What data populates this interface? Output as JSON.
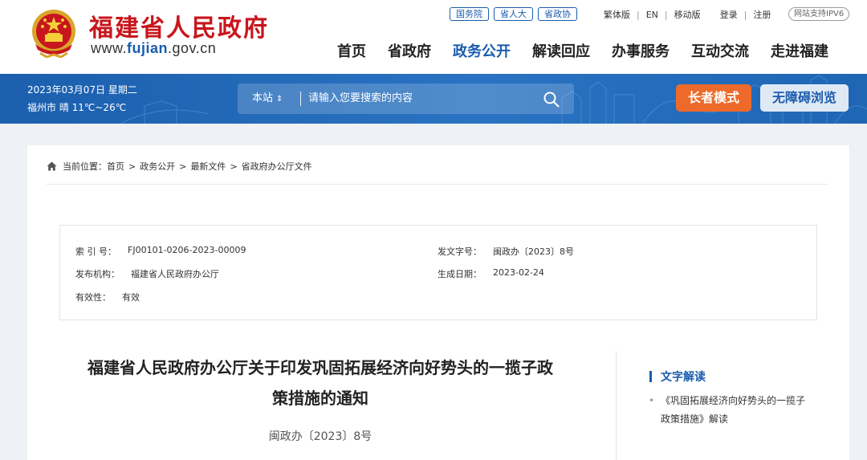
{
  "header": {
    "site_name": "福建省人民政府",
    "site_url_prefix": "www.",
    "site_url_highlight": "fujian",
    "site_url_suffix": ".gov.cn",
    "gov_links": [
      "国务院",
      "省人大",
      "省政协"
    ],
    "top_links": {
      "traditional": "繁体版",
      "english": "EN",
      "mobile": "移动版",
      "login": "登录",
      "register": "注册"
    },
    "ipv6_badge": "网站支持IPV6",
    "nav": [
      {
        "label": "首页",
        "active": false
      },
      {
        "label": "省政府",
        "active": false
      },
      {
        "label": "政务公开",
        "active": true
      },
      {
        "label": "解读回应",
        "active": false
      },
      {
        "label": "办事服务",
        "active": false
      },
      {
        "label": "互动交流",
        "active": false
      },
      {
        "label": "走进福建",
        "active": false
      }
    ]
  },
  "banner": {
    "date": "2023年03月07日 星期二",
    "weather": "福州市 晴 11℃~26℃",
    "search_scope": "本站",
    "search_placeholder": "请输入您要搜索的内容",
    "elder_mode": "长者模式",
    "accessible": "无障碍浏览"
  },
  "breadcrumb": {
    "prefix": "当前位置：",
    "items": [
      "首页",
      "政务公开",
      "最新文件",
      "省政府办公厅文件"
    ]
  },
  "meta": {
    "index_label": "索 引 号：",
    "index_value": "FJ00101-0206-2023-00009",
    "doc_no_label": "发文字号：",
    "doc_no_value": "闽政办〔2023〕8号",
    "issuer_label": "发布机构：",
    "issuer_value": "福建省人民政府办公厅",
    "date_label": "生成日期：",
    "date_value": "2023-02-24",
    "validity_label": "有效性：",
    "validity_value": "有效"
  },
  "article": {
    "title_line1": "福建省人民政府办公厅关于印发巩固拓展经济向好势头的一揽子政",
    "title_line2": "策措施的通知",
    "doc_no": "闽政办〔2023〕8号"
  },
  "sidebar": {
    "title": "文字解读",
    "item_line1": "《巩固拓展经济向好势头的一揽子",
    "item_line2": "政策措施》解读"
  },
  "colors": {
    "brand_red": "#c8161d",
    "brand_blue": "#1a5cad",
    "elder_orange": "#ee6a2a"
  }
}
